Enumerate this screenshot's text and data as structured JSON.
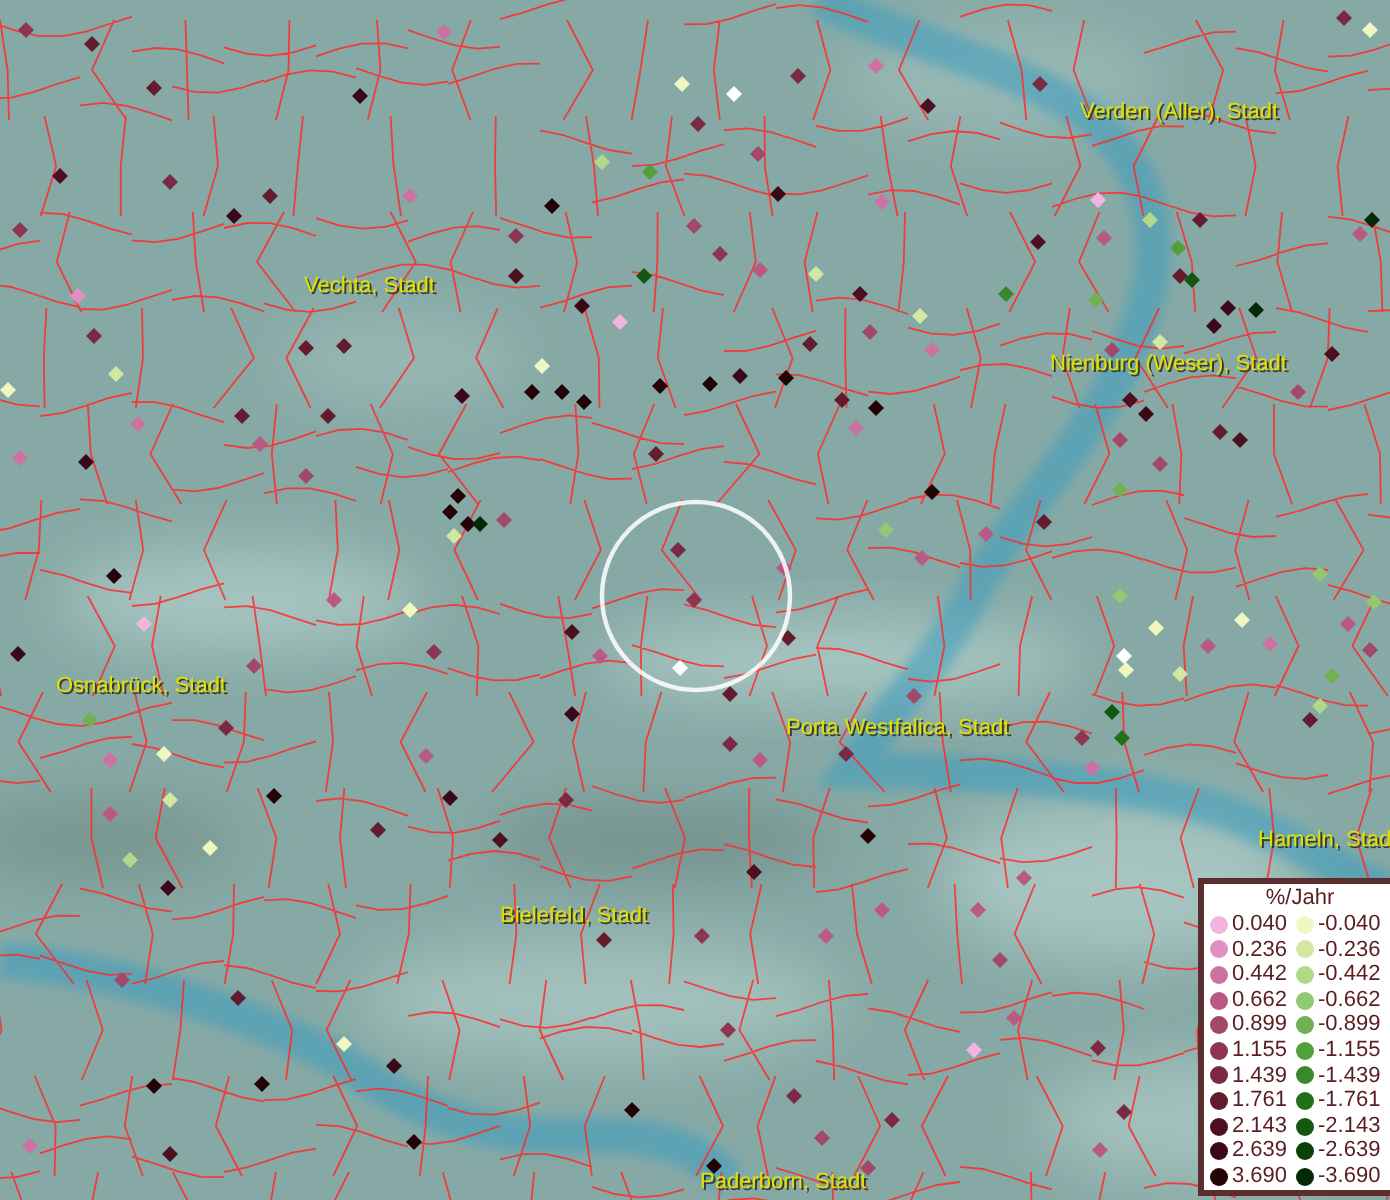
{
  "map": {
    "labels": [
      {
        "text": "Verden (Aller), Stadt"
      },
      {
        "text": "Vechta, Stadt"
      },
      {
        "text": "Nienburg (Weser), Stadt"
      },
      {
        "text": "Osnabrück, Stadt"
      },
      {
        "text": "Porta Westfalica, Stadt"
      },
      {
        "text": "Hameln, Stad"
      },
      {
        "text": "Bielefeld, Stadt"
      },
      {
        "text": "Paderborn, Stadt"
      }
    ]
  },
  "legend": {
    "title": "%/Jahr",
    "positive": [
      {
        "label": "0.040",
        "color": "#f4b4e2"
      },
      {
        "label": "0.236",
        "color": "#e090c2"
      },
      {
        "label": "0.442",
        "color": "#cc72a2"
      },
      {
        "label": "0.662",
        "color": "#b85a84"
      },
      {
        "label": "0.899",
        "color": "#a2486a"
      },
      {
        "label": "1.155",
        "color": "#8c3652"
      },
      {
        "label": "1.439",
        "color": "#7a2a42"
      },
      {
        "label": "1.761",
        "color": "#621c2e"
      },
      {
        "label": "2.143",
        "color": "#4c1020"
      },
      {
        "label": "2.639",
        "color": "#3a0818"
      },
      {
        "label": "3.690",
        "color": "#220408"
      }
    ],
    "negative": [
      {
        "label": "-0.040",
        "color": "#f0f8c2"
      },
      {
        "label": "-0.236",
        "color": "#d2e8a2"
      },
      {
        "label": "-0.442",
        "color": "#b2d88a"
      },
      {
        "label": "-0.662",
        "color": "#92c872"
      },
      {
        "label": "-0.899",
        "color": "#72b052"
      },
      {
        "label": "-1.155",
        "color": "#52a03a"
      },
      {
        "label": "-1.439",
        "color": "#3a882a"
      },
      {
        "label": "-1.761",
        "color": "#22701a"
      },
      {
        "label": "-2.143",
        "color": "#125812"
      },
      {
        "label": "-2.639",
        "color": "#0a400a"
      },
      {
        "label": "-3.690",
        "color": "#032a05"
      }
    ]
  }
}
